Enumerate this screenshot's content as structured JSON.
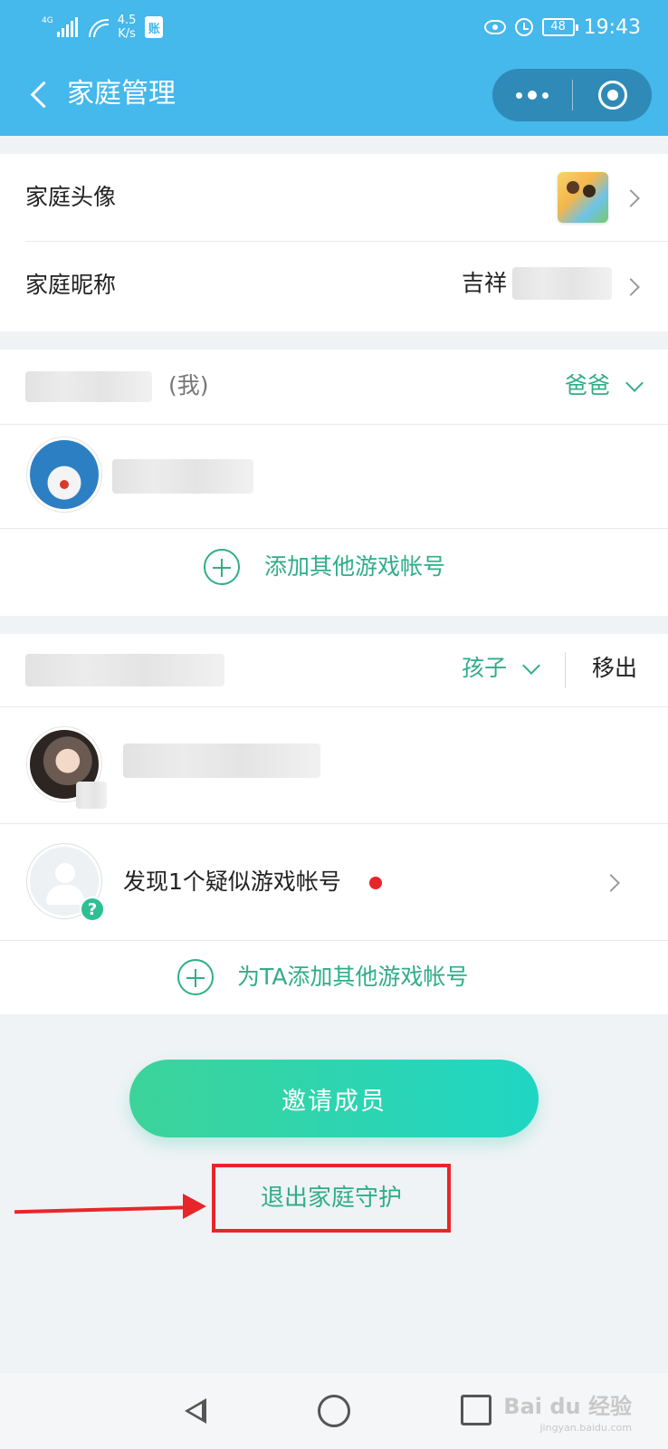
{
  "status_bar": {
    "network": "4G",
    "speed_value": "4.5",
    "speed_unit": "K/s",
    "badge": "账",
    "battery": "48",
    "time": "19:43"
  },
  "title_bar": {
    "title": "家庭管理"
  },
  "family_settings": {
    "avatar_label": "家庭头像",
    "nickname_label": "家庭昵称",
    "nickname_value": "吉祥"
  },
  "members": [
    {
      "self_tag": "(我)",
      "role": "爸爸",
      "add_account_label": "添加其他游戏帐号"
    },
    {
      "role": "孩子",
      "remove_label": "移出",
      "suspected_text": "发现1个疑似游戏帐号",
      "add_account_label": "为TA添加其他游戏帐号"
    }
  ],
  "actions": {
    "invite_label": "邀请成员",
    "exit_label": "退出家庭守护"
  },
  "watermark": {
    "brand": "Bai du 经验",
    "url": "jingyan.baidu.com"
  },
  "colors": {
    "header_blue": "#45b8ec",
    "accent_green": "#2fae88",
    "highlight_red": "#e8262a"
  }
}
